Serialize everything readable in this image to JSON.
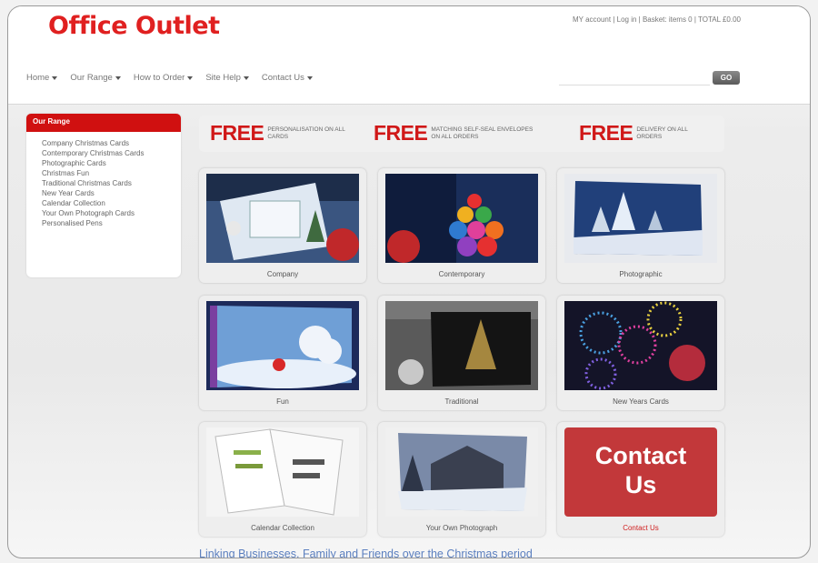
{
  "header": {
    "logo": "Office Outlet",
    "account": "MY account | Log in | Basket: items 0 | TOTAL £0.00",
    "nav": [
      "Home",
      "Our Range",
      "How to Order",
      "Site Help",
      "Contact Us"
    ],
    "search_value": "",
    "go_label": "GO"
  },
  "sidebar": {
    "title": "Our Range",
    "items": [
      "Company Christmas Cards",
      "Contemporary Christmas Cards",
      "Photographic Cards",
      "Christmas Fun",
      "Traditional Christmas Cards",
      "New Year Cards",
      "Calendar Collection",
      "Your Own Photograph Cards",
      "Personalised Pens"
    ]
  },
  "banner": [
    {
      "free": "FREE",
      "text": "PERSONALISATION ON ALL CARDS"
    },
    {
      "free": "FREE",
      "text": "MATCHING SELF-SEAL ENVELOPES ON ALL ORDERS"
    },
    {
      "free": "FREE",
      "text": "DELIVERY ON ALL ORDERS"
    }
  ],
  "tiles": [
    {
      "label": "Company"
    },
    {
      "label": "Contemporary"
    },
    {
      "label": "Photographic"
    },
    {
      "label": "Fun"
    },
    {
      "label": "Traditional"
    },
    {
      "label": "New Years Cards"
    },
    {
      "label": "Calendar Collection"
    },
    {
      "label": "Your Own Photograph"
    },
    {
      "label": "Contact Us",
      "box_text_1": "Contact",
      "box_text_2": "Us"
    }
  ],
  "tagline": "Linking Businesses, Family and Friends over the Christmas period",
  "colors": {
    "brand_red": "#e02020",
    "sidebar_red": "#d01010",
    "contact_box": "#c2383a",
    "link_blue": "#5b7fbf"
  }
}
